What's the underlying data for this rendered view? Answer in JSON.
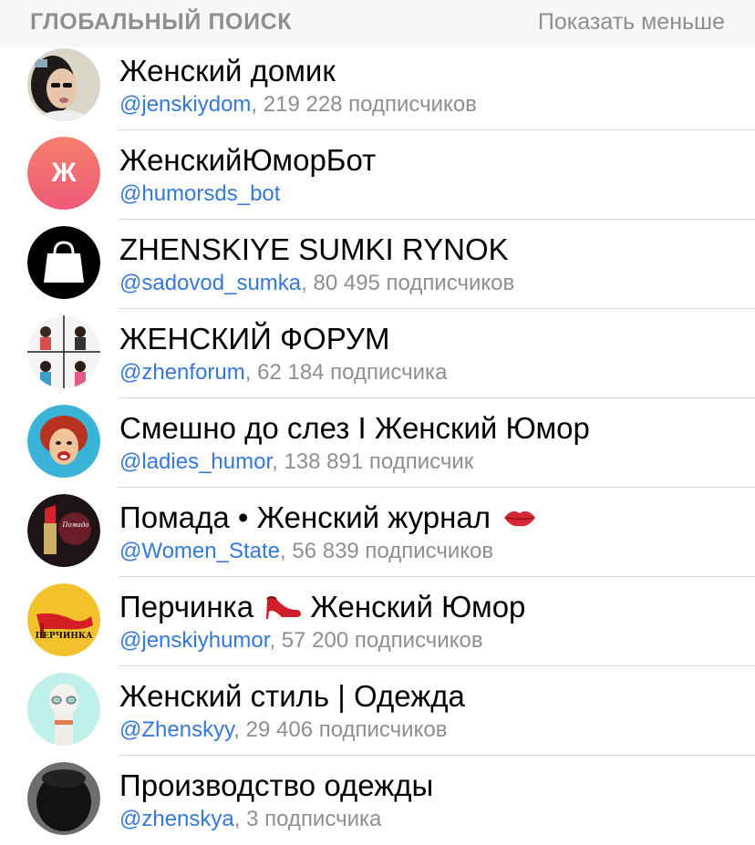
{
  "section": {
    "title": "ГЛОБАЛЬНЫЙ ПОИСК",
    "action_label": "Показать меньше"
  },
  "results": [
    {
      "title": "Женский домик",
      "handle": "@jenskiydom",
      "meta": ", 219 228 подписчиков",
      "avatar_icon": "woman-sunglasses-avatar"
    },
    {
      "title": "ЖенскийЮморБот",
      "handle": "@humorsds_bot",
      "meta": "",
      "avatar_icon": "letter-zh-avatar",
      "avatar_letter": "Ж",
      "avatar_color": "#f36a6a"
    },
    {
      "title": "ZHENSKIYE SUMKI RYNOK",
      "handle": "@sadovod_sumka",
      "meta": ", 80 495 подписчиков",
      "avatar_icon": "shopping-bag-avatar"
    },
    {
      "title": "ЖЕНСКИЙ ФОРУМ",
      "handle": "@zhenforum",
      "meta": ", 62 184 подписчика",
      "avatar_icon": "forum-collage-avatar"
    },
    {
      "title": "Смешно до слез I Женский Юмор",
      "handle": "@ladies_humor",
      "meta": ", 138 891 подписчик",
      "avatar_icon": "popart-woman-avatar"
    },
    {
      "title": "Помада • Женский журнал",
      "handle": "@Women_State",
      "meta": ", 56 839 подписчиков",
      "avatar_icon": "lipstick-avatar",
      "title_emoji": "lips-icon",
      "avatar_caption": "Помада"
    },
    {
      "title_before": "Перчинка",
      "title_after": "Женский Юмор",
      "handle": "@jenskiyhumor",
      "meta": ", 57 200 подписчиков",
      "avatar_icon": "red-shoe-avatar",
      "title_emoji": "high-heel-icon",
      "avatar_caption": "ПЕРЧИНКА"
    },
    {
      "title": "Женский стиль | Одежда",
      "handle": "@Zhenskyy",
      "meta": ", 29 406 подписчиков",
      "avatar_icon": "llama-avatar"
    },
    {
      "title": "Производство одежды",
      "handle": "@zhenskya",
      "meta": ", 3 подписчика",
      "avatar_icon": "black-cap-avatar"
    }
  ],
  "colors": {
    "link": "#3478d9",
    "secondary_text": "#8e8e93",
    "header_bg": "#f7f7f7"
  }
}
